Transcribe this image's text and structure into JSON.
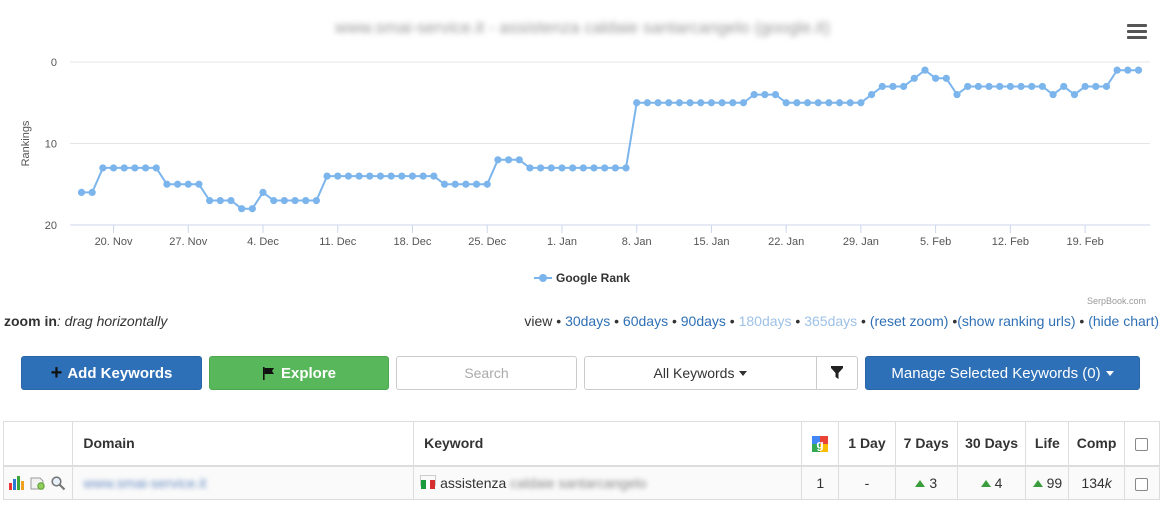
{
  "chart": {
    "title": "www.smai-service.it - assistenza caldaie santarcangelo (google.it)",
    "credits": "SerpBook.com"
  },
  "chart_data": {
    "type": "line",
    "ylabel": "Rankings",
    "ylim": [
      0,
      20
    ],
    "y_reversed": true,
    "yticks": [
      0,
      10,
      20
    ],
    "xticks": [
      "20. Nov",
      "27. Nov",
      "4. Dec",
      "11. Dec",
      "18. Dec",
      "25. Dec",
      "1. Jan",
      "8. Jan",
      "15. Jan",
      "22. Jan",
      "29. Jan",
      "5. Feb",
      "12. Feb",
      "19. Feb"
    ],
    "legend_position": "bottom",
    "series": [
      {
        "name": "Google Rank",
        "color": "#7cb5ec",
        "start_date": "17. Nov",
        "values": [
          16,
          16,
          13,
          13,
          13,
          13,
          13,
          13,
          15,
          15,
          15,
          15,
          17,
          17,
          17,
          18,
          18,
          16,
          17,
          17,
          17,
          17,
          17,
          14,
          14,
          14,
          14,
          14,
          14,
          14,
          14,
          14,
          14,
          14,
          15,
          15,
          15,
          15,
          15,
          12,
          12,
          12,
          13,
          13,
          13,
          13,
          13,
          13,
          13,
          13,
          13,
          13,
          5,
          5,
          5,
          5,
          5,
          5,
          5,
          5,
          5,
          5,
          5,
          4,
          4,
          4,
          5,
          5,
          5,
          5,
          5,
          5,
          5,
          5,
          4,
          3,
          3,
          3,
          2,
          1,
          2,
          2,
          4,
          3,
          3,
          3,
          3,
          3,
          3,
          3,
          3,
          4,
          3,
          4,
          3,
          3,
          3,
          1,
          1,
          1
        ]
      }
    ]
  },
  "zoom": {
    "hint_bold": "zoom in",
    "hint_text": ": drag horizontally"
  },
  "view": {
    "label": "view",
    "links": [
      "30days",
      "60days",
      "90days",
      "180days",
      "365days",
      "(reset zoom)",
      "(show ranking urls)",
      "(hide chart)"
    ]
  },
  "toolbar": {
    "add_label": "Add Keywords",
    "explore_label": "Explore",
    "search_placeholder": "Search",
    "dropdown_label": "All Keywords",
    "manage_label": "Manage Selected Keywords (0)"
  },
  "table": {
    "headers": {
      "domain": "Domain",
      "keyword": "Keyword",
      "day1": "1 Day",
      "day7": "7 Days",
      "day30": "30 Days",
      "life": "Life",
      "comp": "Comp"
    },
    "rows": [
      {
        "domain": "www.smai-service.it",
        "keyword_visible": "assistenza",
        "keyword_hidden": " caldaie santarcangelo",
        "rank": "1",
        "day1": "-",
        "day7": "3",
        "day30": "4",
        "life": "99",
        "comp": "134",
        "comp_suffix": "k"
      }
    ]
  }
}
